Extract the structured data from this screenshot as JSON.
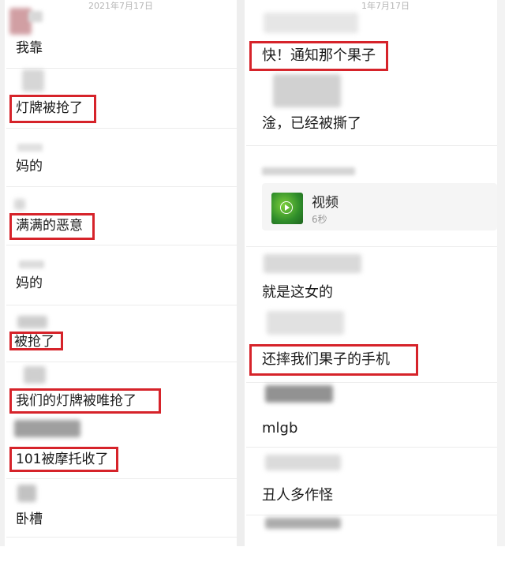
{
  "left": {
    "date": "2021年7月17日",
    "messages": [
      {
        "text": "我靠"
      },
      {
        "text": "灯牌被抢了"
      },
      {
        "text": "妈的"
      },
      {
        "text": "满满的恶意"
      },
      {
        "text": "妈的"
      },
      {
        "text": "被抢了"
      },
      {
        "text": "我们的灯牌被唯抢了"
      },
      {
        "text": "101被摩托收了"
      },
      {
        "text": "卧槽"
      }
    ]
  },
  "right": {
    "date": "1年7月17日",
    "messages": [
      {
        "text": "快！通知那个果子"
      },
      {
        "text": "淦，已经被撕了"
      },
      {
        "text": "就是这女的"
      },
      {
        "text": "还摔我们果子的手机"
      },
      {
        "text": "mlgb"
      },
      {
        "text": "丑人多作怪"
      }
    ],
    "video": {
      "label": "视频",
      "duration": "6秒",
      "icon": "play-icon"
    }
  },
  "colors": {
    "highlight": "#d6232a",
    "separator": "#ececec",
    "date_text": "#b5b5b5"
  }
}
